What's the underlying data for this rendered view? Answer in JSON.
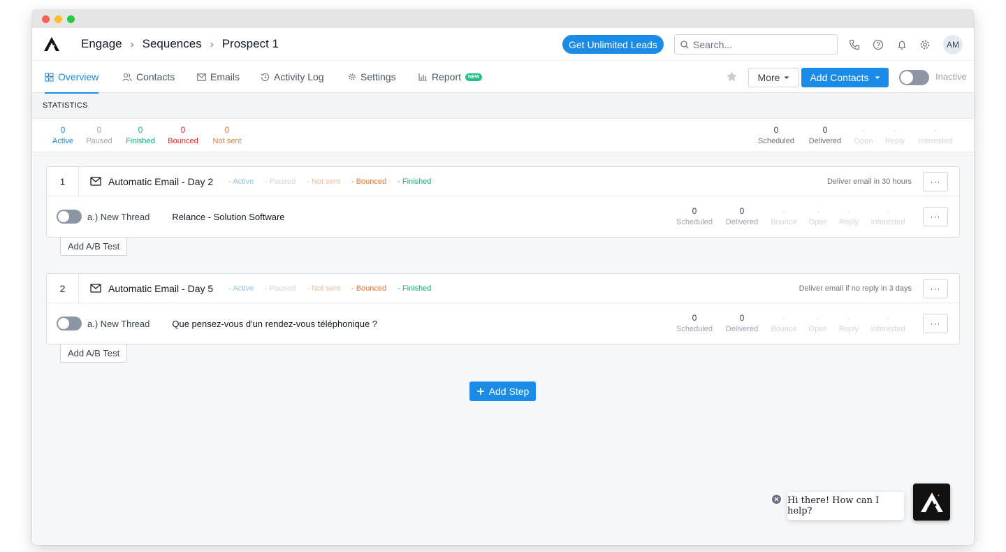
{
  "header": {
    "breadcrumbs": [
      "Engage",
      "Sequences",
      "Prospect 1"
    ],
    "unlimited_label": "Get Unlimited Leads",
    "search_placeholder": "Search...",
    "avatar_initials": "AM"
  },
  "tabs": [
    {
      "label": "Overview",
      "active": true,
      "icon": "grid-icon"
    },
    {
      "label": "Contacts",
      "icon": "users-icon"
    },
    {
      "label": "Emails",
      "icon": "mail-icon"
    },
    {
      "label": "Activity Log",
      "icon": "history-icon"
    },
    {
      "label": "Settings",
      "icon": "gear-icon"
    },
    {
      "label": "Report",
      "icon": "bar-chart-icon",
      "badge": "NEW"
    }
  ],
  "actions": {
    "more_label": "More",
    "add_contacts_label": "Add Contacts",
    "status_label": "Inactive"
  },
  "statistics": {
    "heading": "STATISTICS",
    "left": [
      {
        "value": "0",
        "label": "Active"
      },
      {
        "value": "0",
        "label": "Paused"
      },
      {
        "value": "0",
        "label": "Finished"
      },
      {
        "value": "0",
        "label": "Bounced"
      },
      {
        "value": "0",
        "label": "Not sent"
      }
    ],
    "right": [
      {
        "value": "0",
        "label": "Scheduled"
      },
      {
        "value": "0",
        "label": "Delivered"
      },
      {
        "value": "-",
        "label": "Open"
      },
      {
        "value": "-",
        "label": "Reply"
      },
      {
        "value": "-",
        "label": "Interested"
      }
    ]
  },
  "steps": [
    {
      "number": "1",
      "title": "Automatic Email - Day 2",
      "chips": [
        "- Active",
        "- Paused",
        "- Not sent",
        "- Bounced",
        "- Finished"
      ],
      "deliver": "Deliver email in 30 hours",
      "thread": "a.) New Thread",
      "subject": "Relance - Solution Software",
      "stats": [
        {
          "value": "0",
          "label": "Scheduled"
        },
        {
          "value": "0",
          "label": "Delivered"
        },
        {
          "value": "-",
          "label": "Bounce"
        },
        {
          "value": "-",
          "label": "Open"
        },
        {
          "value": "-",
          "label": "Reply"
        },
        {
          "value": "-",
          "label": "Interested"
        }
      ],
      "ab_label": "Add A/B Test",
      "menu": "···"
    },
    {
      "number": "2",
      "title": "Automatic Email - Day 5",
      "chips": [
        "- Active",
        "- Paused",
        "- Not sent",
        "- Bounced",
        "- Finished"
      ],
      "deliver": "Deliver email if no reply in 3 days",
      "thread": "a.) New Thread",
      "subject": "Que pensez-vous d'un rendez-vous téléphonique ?",
      "stats": [
        {
          "value": "0",
          "label": "Scheduled"
        },
        {
          "value": "0",
          "label": "Delivered"
        },
        {
          "value": "-",
          "label": "Bounce"
        },
        {
          "value": "-",
          "label": "Open"
        },
        {
          "value": "-",
          "label": "Reply"
        },
        {
          "value": "-",
          "label": "Interested"
        }
      ],
      "ab_label": "Add A/B Test",
      "menu": "···"
    }
  ],
  "add_step_label": "Add Step",
  "chat": {
    "message": "Hi there! How can I help?"
  },
  "colors": {
    "accent": "#1a8be6",
    "green": "#22a87a",
    "red": "#dc2626",
    "orange": "#f0742e"
  }
}
